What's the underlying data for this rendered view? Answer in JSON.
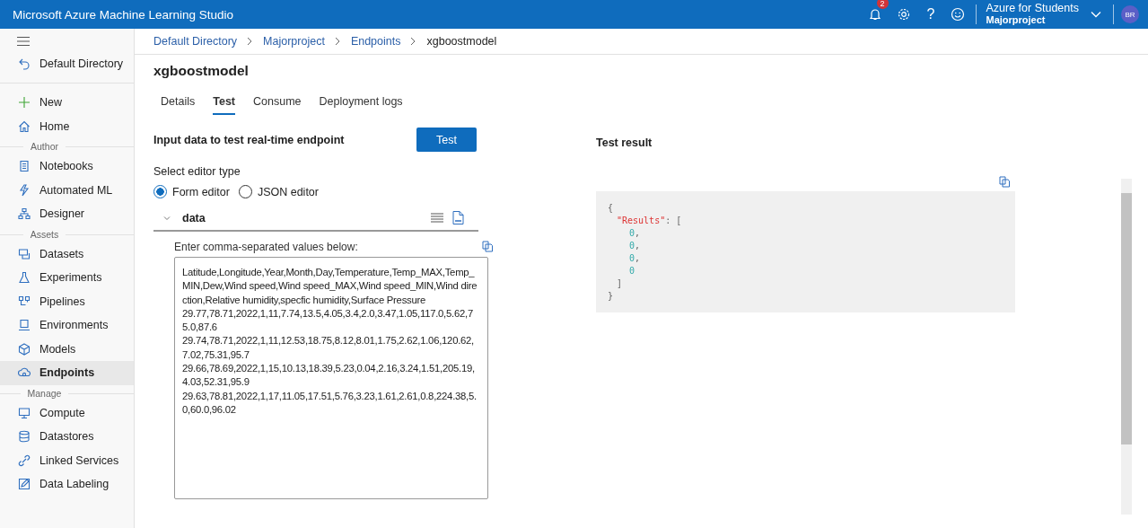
{
  "app_bar": {
    "title": "Microsoft Azure Machine Learning Studio",
    "notification_count": "2",
    "help": "?",
    "subscription": "Azure for Students",
    "workspace": "Majorproject",
    "avatar": "BR"
  },
  "sidebar": {
    "items": [
      {
        "kind": "back",
        "label": "Default Directory",
        "selected": false
      },
      {
        "kind": "item",
        "label": "New",
        "selected": false
      },
      {
        "kind": "item",
        "label": "Home",
        "selected": false
      },
      {
        "kind": "heading",
        "label": "Author"
      },
      {
        "kind": "item",
        "label": "Notebooks",
        "selected": false
      },
      {
        "kind": "item",
        "label": "Automated ML",
        "selected": false
      },
      {
        "kind": "item",
        "label": "Designer",
        "selected": false
      },
      {
        "kind": "heading",
        "label": "Assets"
      },
      {
        "kind": "item",
        "label": "Datasets",
        "selected": false
      },
      {
        "kind": "item",
        "label": "Experiments",
        "selected": false
      },
      {
        "kind": "item",
        "label": "Pipelines",
        "selected": false
      },
      {
        "kind": "item",
        "label": "Environments",
        "selected": false
      },
      {
        "kind": "item",
        "label": "Models",
        "selected": false
      },
      {
        "kind": "item",
        "label": "Endpoints",
        "selected": true
      },
      {
        "kind": "heading",
        "label": "Manage"
      },
      {
        "kind": "item",
        "label": "Compute",
        "selected": false
      },
      {
        "kind": "item",
        "label": "Datastores",
        "selected": false
      },
      {
        "kind": "item",
        "label": "Linked Services",
        "selected": false
      },
      {
        "kind": "item",
        "label": "Data Labeling",
        "selected": false
      }
    ]
  },
  "breadcrumb": [
    "Default Directory",
    "Majorproject",
    "Endpoints",
    "xgboostmodel"
  ],
  "page_title": "xgboostmodel",
  "tabs": [
    {
      "label": "Details",
      "selected": false
    },
    {
      "label": "Test",
      "selected": true
    },
    {
      "label": "Consume",
      "selected": false
    },
    {
      "label": "Deployment logs",
      "selected": false
    }
  ],
  "input_panel": {
    "heading": "Input data to test real-time endpoint",
    "test_button": "Test",
    "editor_label": "Select editor type",
    "editor_options": [
      {
        "label": "Form editor",
        "selected": true
      },
      {
        "label": "JSON editor",
        "selected": false
      }
    ],
    "section": {
      "label": "data",
      "expanded": true
    },
    "field_label": "Enter comma-separated values below:",
    "value": "Latitude,Longitude,Year,Month,Day,Temperature,Temp_MAX,Temp_MIN,Dew,Wind speed,Wind speed_MAX,Wind speed_MIN,Wind direction,Relative humidity,specfic humidity,Surface Pressure\n29.77,78.71,2022,1,11,7.74,13.5,4.05,3.4,2.0,3.47,1.05,117.0,5.62,75.0,87.6\n29.74,78.71,2022,1,11,12.53,18.75,8.12,8.01,1.75,2.62,1.06,120.62,7.02,75.31,95.7\n29.66,78.69,2022,1,15,10.13,18.39,5.23,0.04,2.16,3.24,1.51,205.19,4.03,52.31,95.9\n29.63,78.81,2022,1,17,11.05,17.51,5.76,3.23,1.61,2.61,0.8,224.38,5.0,60.0,96.02"
  },
  "result_panel": {
    "heading": "Test result",
    "result": {
      "open": "{",
      "key": "\"Results\"",
      "colon": ":",
      "list_open": "[",
      "values": [
        "0",
        "0",
        "0",
        "0"
      ],
      "separator": ",",
      "list_close": "]",
      "close": "}"
    }
  }
}
